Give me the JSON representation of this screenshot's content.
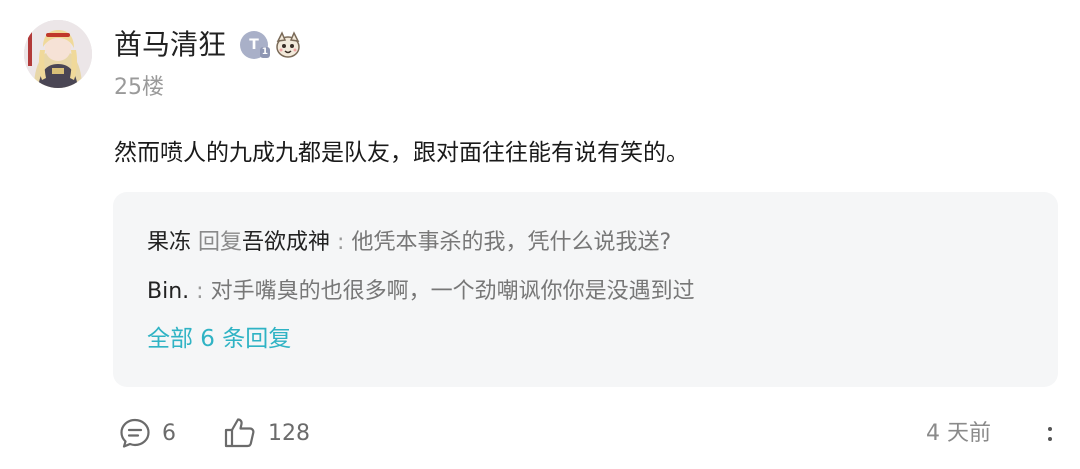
{
  "post": {
    "username": "酋马清狂",
    "level_badge": "T",
    "level_sub": "1",
    "floor": "25楼",
    "content": "然而喷人的九成九都是队友，跟对面往往能有说有笑的。"
  },
  "replies": [
    {
      "user": "果冻",
      "verb": "回复",
      "target": "吾欲成神",
      "separator": " : ",
      "text": "他凭本事杀的我，凭什么说我送?"
    },
    {
      "user": "Bin.",
      "verb": "",
      "target": "",
      "separator": " : ",
      "text": "对手嘴臭的也很多啊，一个劲嘲讽你你是没遇到过"
    }
  ],
  "all_replies_label": "全部 6 条回复",
  "footer": {
    "comment_count": "6",
    "like_count": "128",
    "time_ago": "4 天前"
  },
  "colors": {
    "link": "#2fb3c4",
    "reply_bg": "#f5f6f7",
    "muted": "#8a8a8a"
  },
  "icons": {
    "comment": "comment-bubble-icon",
    "like": "thumbs-up-icon",
    "more": "more-vertical-icon",
    "level": "level-badge-icon",
    "sticker": "anime-sticker-icon"
  }
}
